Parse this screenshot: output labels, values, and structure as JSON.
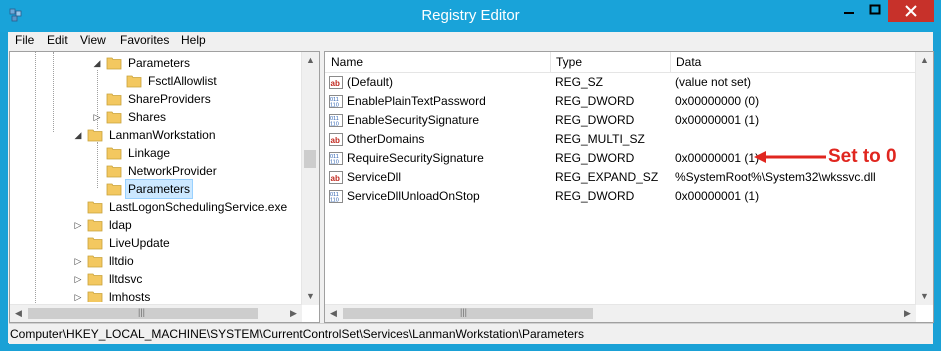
{
  "window": {
    "title": "Registry Editor",
    "controls": {
      "minimize": "minimize",
      "maximize": "maximize",
      "close": "close"
    }
  },
  "menu": [
    "File",
    "Edit",
    "View",
    "Favorites",
    "Help"
  ],
  "tree": [
    {
      "label": "Parameters",
      "expander": "open",
      "selected": false
    },
    {
      "label": "FsctlAllowlist",
      "expander": "none",
      "selected": false
    },
    {
      "label": "ShareProviders",
      "expander": "none",
      "selected": false
    },
    {
      "label": "Shares",
      "expander": "closed",
      "selected": false
    },
    {
      "label": "LanmanWorkstation",
      "expander": "open",
      "selected": false
    },
    {
      "label": "Linkage",
      "expander": "none",
      "selected": false
    },
    {
      "label": "NetworkProvider",
      "expander": "none",
      "selected": false
    },
    {
      "label": "Parameters",
      "expander": "none",
      "selected": true
    },
    {
      "label": "LastLogonSchedulingService.exe",
      "expander": "none",
      "selected": false
    },
    {
      "label": "ldap",
      "expander": "closed",
      "selected": false
    },
    {
      "label": "LiveUpdate",
      "expander": "none",
      "selected": false
    },
    {
      "label": "lltdio",
      "expander": "closed",
      "selected": false
    },
    {
      "label": "lltdsvc",
      "expander": "closed",
      "selected": false
    },
    {
      "label": "lmhosts",
      "expander": "closed",
      "selected": false
    }
  ],
  "columns": {
    "name": "Name",
    "type": "Type",
    "data": "Data"
  },
  "values": [
    {
      "icon": "string-value-icon",
      "name": "(Default)",
      "type": "REG_SZ",
      "data": "(value not set)"
    },
    {
      "icon": "binary-value-icon",
      "name": "EnablePlainTextPassword",
      "type": "REG_DWORD",
      "data": "0x00000000 (0)"
    },
    {
      "icon": "binary-value-icon",
      "name": "EnableSecuritySignature",
      "type": "REG_DWORD",
      "data": "0x00000001 (1)"
    },
    {
      "icon": "string-value-icon",
      "name": "OtherDomains",
      "type": "REG_MULTI_SZ",
      "data": ""
    },
    {
      "icon": "binary-value-icon",
      "name": "RequireSecuritySignature",
      "type": "REG_DWORD",
      "data": "0x00000001 (1)"
    },
    {
      "icon": "string-value-icon",
      "name": "ServiceDll",
      "type": "REG_EXPAND_SZ",
      "data": "%SystemRoot%\\System32\\wkssvc.dll"
    },
    {
      "icon": "binary-value-icon",
      "name": "ServiceDllUnloadOnStop",
      "type": "REG_DWORD",
      "data": "0x00000001 (1)"
    }
  ],
  "status": "Computer\\HKEY_LOCAL_MACHINE\\SYSTEM\\CurrentControlSet\\Services\\LanmanWorkstation\\Parameters",
  "annotation": {
    "text": "Set to 0",
    "color": "#e0261f"
  },
  "colors": {
    "titlebar": "#19a3d9",
    "close": "#c7312a",
    "selection": "#cce8ff"
  }
}
